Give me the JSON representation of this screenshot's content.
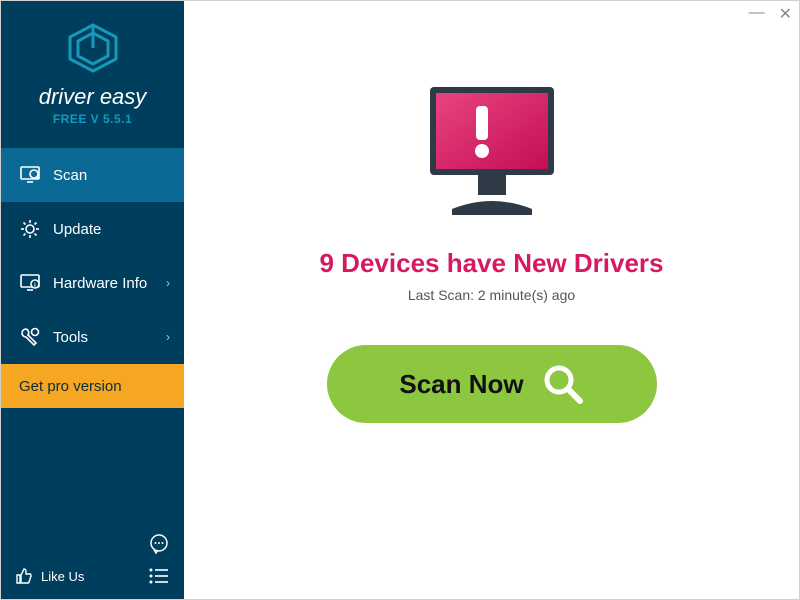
{
  "app": {
    "name": "driver easy",
    "version_line": "FREE V 5.5.1"
  },
  "sidebar": {
    "items": [
      {
        "label": "Scan"
      },
      {
        "label": "Update"
      },
      {
        "label": "Hardware Info"
      },
      {
        "label": "Tools"
      }
    ],
    "get_pro": "Get pro version",
    "like_us": "Like Us"
  },
  "main": {
    "status": "9 Devices have New Drivers",
    "last_scan": "Last Scan: 2 minute(s) ago",
    "scan_button": "Scan Now"
  },
  "colors": {
    "accent": "#d71a60",
    "scan_green": "#8dc63f",
    "sidebar_bg": "#003e5d",
    "pro_orange": "#f5a623"
  }
}
